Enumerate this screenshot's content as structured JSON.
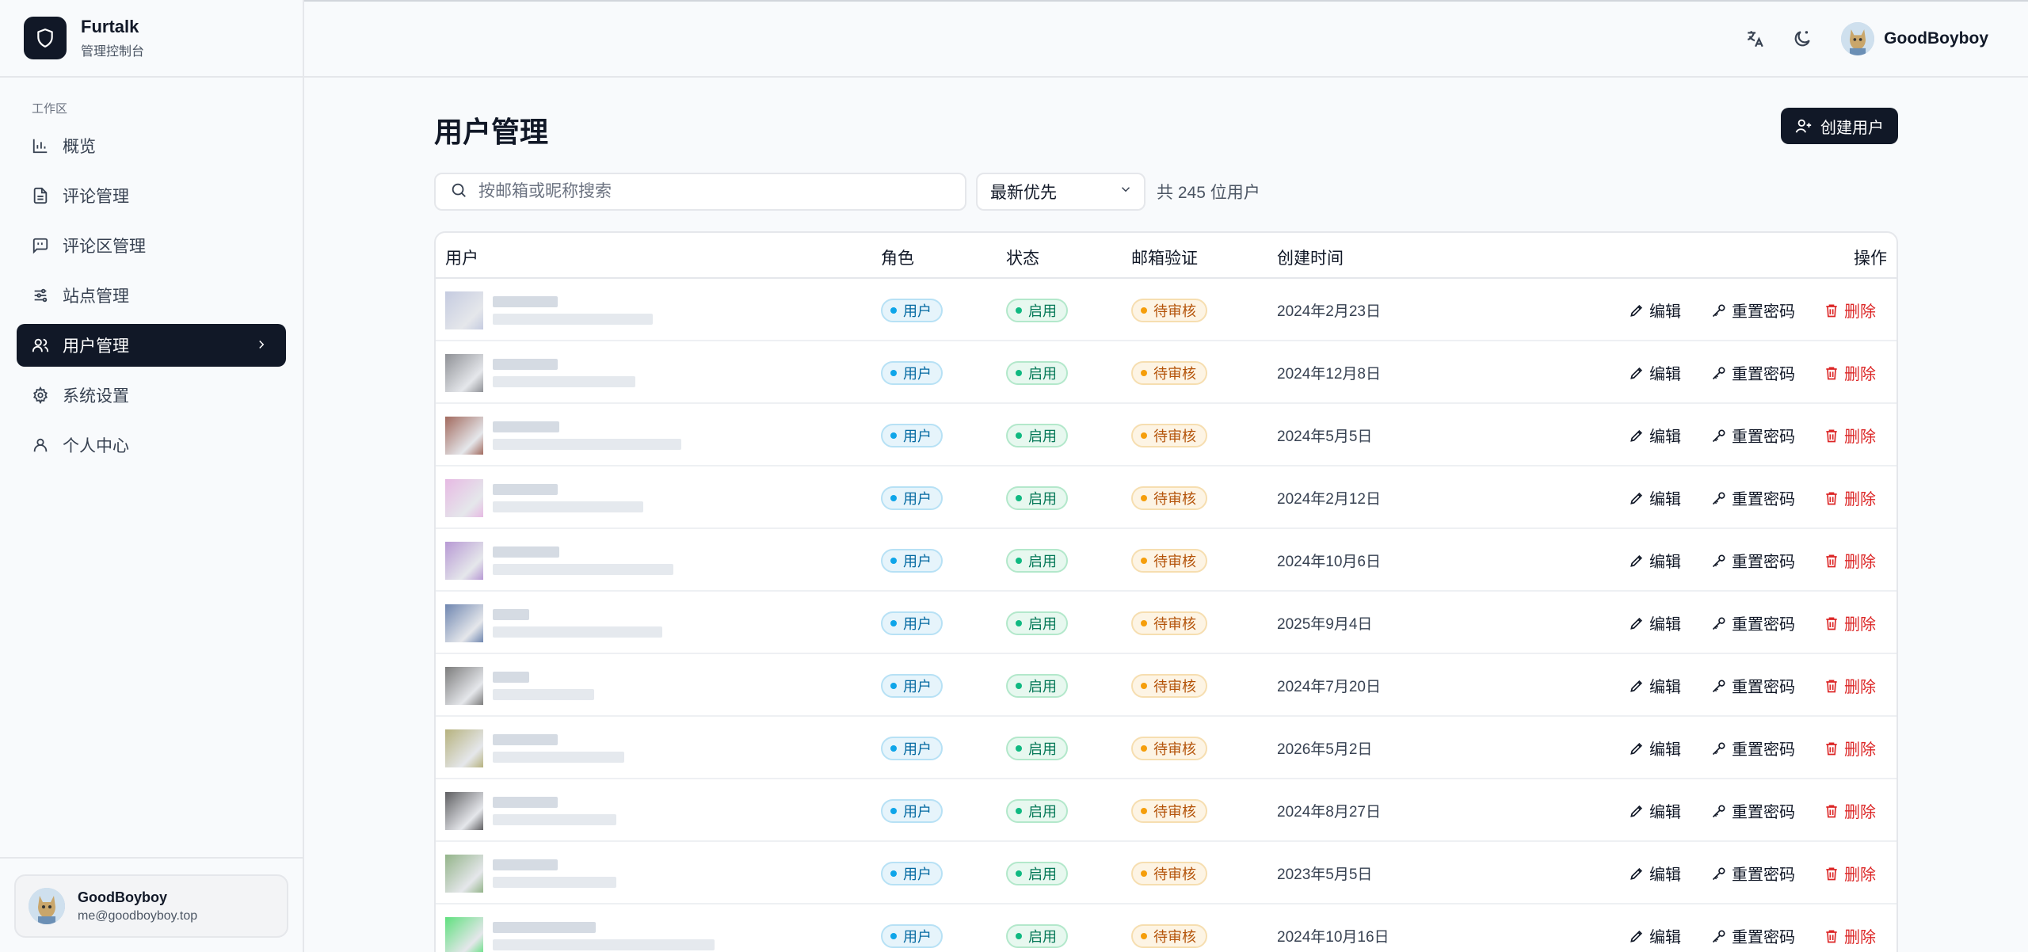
{
  "app": {
    "name": "Furtalk",
    "subtitle": "管理控制台"
  },
  "sidebar": {
    "section_label": "工作区",
    "items": [
      {
        "label": "概览",
        "icon": "chart-icon"
      },
      {
        "label": "评论管理",
        "icon": "document-icon"
      },
      {
        "label": "评论区管理",
        "icon": "comment-box-icon"
      },
      {
        "label": "站点管理",
        "icon": "sliders-icon"
      },
      {
        "label": "用户管理",
        "icon": "users-icon",
        "active": true
      },
      {
        "label": "系统设置",
        "icon": "gear-icon"
      },
      {
        "label": "个人中心",
        "icon": "user-icon"
      }
    ],
    "user": {
      "name": "GoodBoyboy",
      "email": "me@goodboyboy.top"
    }
  },
  "header": {
    "user_name": "GoodBoyboy"
  },
  "main": {
    "title": "用户管理",
    "create_button": "创建用户",
    "search_placeholder": "按邮箱或昵称搜索",
    "sort_value": "最新优先",
    "count_text": "共 245 位用户",
    "columns": {
      "user": "用户",
      "role": "角色",
      "status": "状态",
      "email_verify": "邮箱验证",
      "created": "创建时间",
      "actions": "操作"
    },
    "actions": {
      "edit": "编辑",
      "reset": "重置密码",
      "delete": "删除"
    },
    "rows": [
      {
        "role": "用户",
        "status": "启用",
        "email_verify": "待审核",
        "created": "2024年2月23日",
        "avatar_color": "#c5cbe0"
      },
      {
        "role": "用户",
        "status": "启用",
        "email_verify": "待审核",
        "created": "2024年12月8日",
        "avatar_color": "#8f9196"
      },
      {
        "role": "用户",
        "status": "启用",
        "email_verify": "待审核",
        "created": "2024年5月5日",
        "avatar_color": "#a26a5e"
      },
      {
        "role": "用户",
        "status": "启用",
        "email_verify": "待审核",
        "created": "2024年2月12日",
        "avatar_color": "#e6b9e3"
      },
      {
        "role": "用户",
        "status": "启用",
        "email_verify": "待审核",
        "created": "2024年10月6日",
        "avatar_color": "#b799d4"
      },
      {
        "role": "用户",
        "status": "启用",
        "email_verify": "待审核",
        "created": "2025年9月4日",
        "avatar_color": "#6f86b0"
      },
      {
        "role": "用户",
        "status": "启用",
        "email_verify": "待审核",
        "created": "2024年7月20日",
        "avatar_color": "#7c7c7c"
      },
      {
        "role": "用户",
        "status": "启用",
        "email_verify": "待审核",
        "created": "2026年5月2日",
        "avatar_color": "#b6b27e"
      },
      {
        "role": "用户",
        "status": "启用",
        "email_verify": "待审核",
        "created": "2024年8月27日",
        "avatar_color": "#5f5f62"
      },
      {
        "role": "用户",
        "status": "启用",
        "email_verify": "待审核",
        "created": "2023年5月5日",
        "avatar_color": "#93b489"
      },
      {
        "role": "用户",
        "status": "启用",
        "email_verify": "待审核",
        "created": "2024年10月16日",
        "avatar_color": "#5fe07e"
      }
    ]
  }
}
